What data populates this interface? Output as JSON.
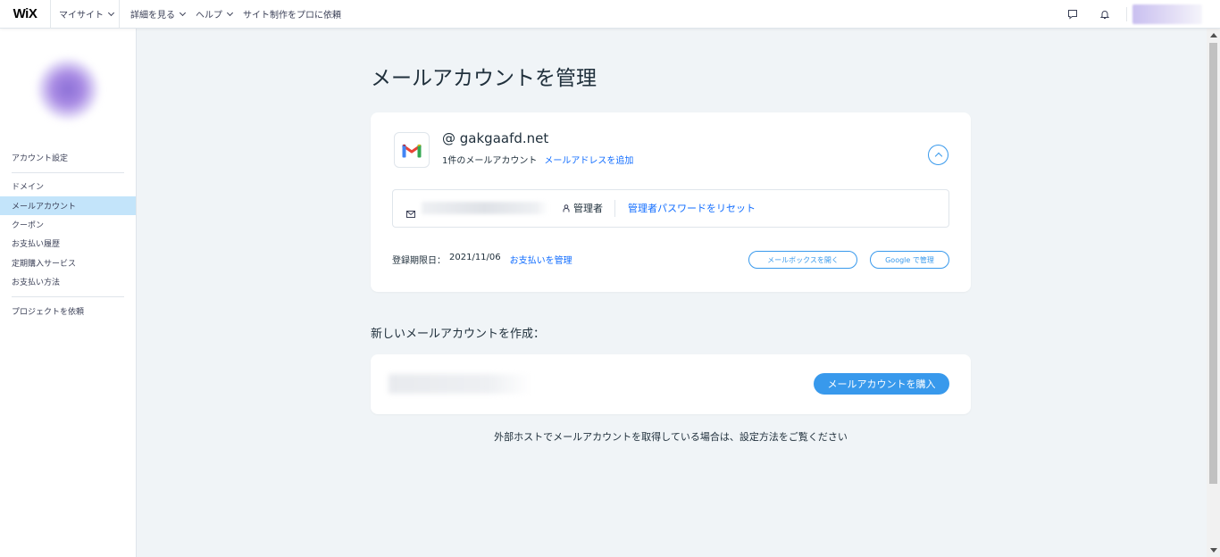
{
  "topbar": {
    "logo": "WiX",
    "mysite": "マイサイト",
    "nav": [
      "詳細を見る",
      "ヘルプ",
      "サイト制作をプロに依頼"
    ]
  },
  "sidebar": {
    "items": [
      {
        "label": "アカウント設定",
        "active": false
      },
      {
        "label": "ドメイン",
        "active": false
      },
      {
        "label": "メールアカウント",
        "active": true
      },
      {
        "label": "クーポン",
        "active": false
      },
      {
        "label": "お支払い履歴",
        "active": false
      },
      {
        "label": "定期購入サービス",
        "active": false
      },
      {
        "label": "お支払い方法",
        "active": false
      },
      {
        "label": "プロジェクトを依頼",
        "active": false
      }
    ]
  },
  "main": {
    "title": "メールアカウントを管理",
    "account_card": {
      "domain": "@ gakgaafd.net",
      "count_text": "1件のメールアカウント",
      "add_link": "メールアドレスを追加",
      "role": "管理者",
      "reset_link": "管理者パスワードをリセット",
      "expiry_label": "登録期限日：",
      "expiry_date": "2021/11/06",
      "manage_payment_link": "お支払いを管理",
      "open_mailbox_button": "メールボックスを開く",
      "google_manage_button": "Google で管理"
    },
    "new_section_title": "新しいメールアカウントを作成：",
    "buy_button": "メールアカウントを購入",
    "footer_note": "外部ホストでメールアカウントを取得している場合は、設定方法をご覧ください"
  },
  "colors": {
    "accent": "#3899ec",
    "link": "#116dff",
    "active_nav": "#c3e4fa",
    "background": "#f0f4f7"
  }
}
